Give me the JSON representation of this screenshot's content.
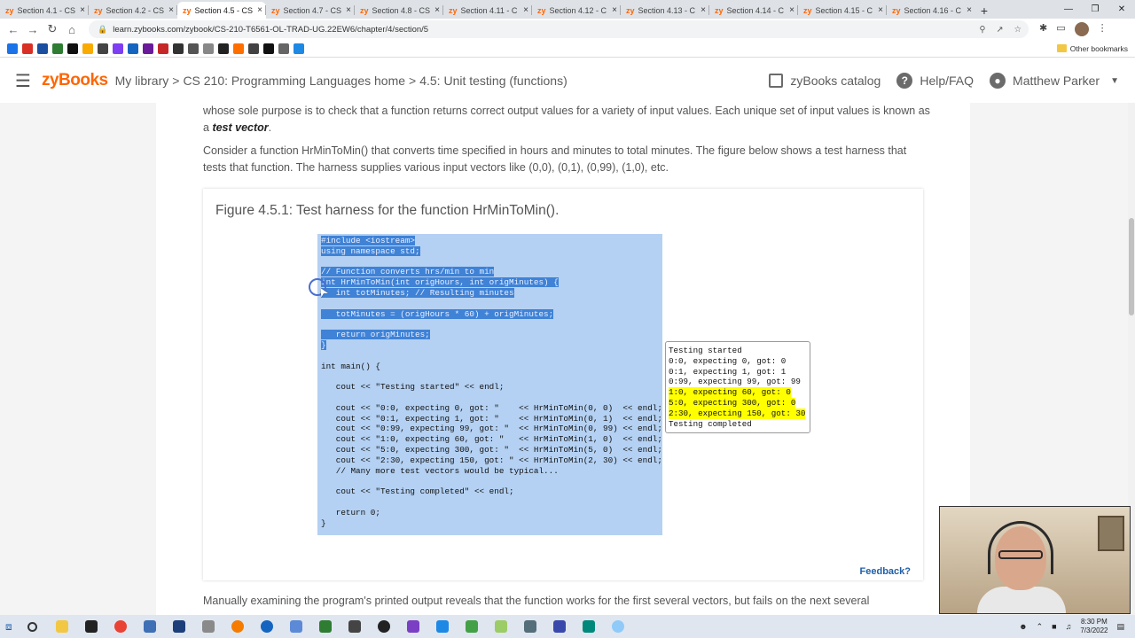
{
  "browser": {
    "tabs": [
      {
        "label": "Section 4.1 - CS",
        "active": false
      },
      {
        "label": "Section 4.2 - CS",
        "active": false
      },
      {
        "label": "Section 4.5 - CS",
        "active": true
      },
      {
        "label": "Section 4.7 - CS",
        "active": false
      },
      {
        "label": "Section 4.8 - CS",
        "active": false
      },
      {
        "label": "Section 4.11 - C",
        "active": false
      },
      {
        "label": "Section 4.12 - C",
        "active": false
      },
      {
        "label": "Section 4.13 - C",
        "active": false
      },
      {
        "label": "Section 4.14 - C",
        "active": false
      },
      {
        "label": "Section 4.15 - C",
        "active": false
      },
      {
        "label": "Section 4.16 - C",
        "active": false
      }
    ],
    "tab_favicon": "zy",
    "url": "learn.zybooks.com/zybook/CS-210-T6561-OL-TRAD-UG.22EW6/chapter/4/section/5",
    "other_bookmarks": "Other bookmarks"
  },
  "header": {
    "logo": "zyBooks",
    "breadcrumb": [
      "My library",
      "CS 210: Programming Languages home",
      "4.5: Unit testing (functions)"
    ],
    "breadcrumb_sep": ">",
    "catalog": "zyBooks catalog",
    "help": "Help/FAQ",
    "user": "Matthew Parker"
  },
  "content": {
    "para1_text": "whose sole purpose is to check that a function returns correct output values for a variety of input values. Each unique set of input values is known as a ",
    "para1_term": "test vector",
    "para1_end": ".",
    "para2": "Consider a function HrMinToMin() that converts time specified in hours and minutes to total minutes. The figure below shows a test harness that tests that function. The harness supplies various input vectors like (0,0), (0,1), (0,99), (1,0), etc.",
    "figure_title": "Figure 4.5.1: Test harness for the function HrMinToMin().",
    "code_lines": [
      "#include <iostream>",
      "using namespace std;",
      "",
      "// Function converts hrs/min to min",
      "int HrMinToMin(int origHours, int origMinutes) {",
      "   int totMinutes; // Resulting minutes",
      "",
      "   totMinutes = (origHours * 60) + origMinutes;",
      "",
      "   return origMinutes;",
      "}",
      "",
      "int main() {",
      "",
      "   cout << \"Testing started\" << endl;",
      "",
      "   cout << \"0:0, expecting 0, got: \"    << HrMinToMin(0, 0)  << endl;",
      "   cout << \"0:1, expecting 1, got: \"    << HrMinToMin(0, 1)  << endl;",
      "   cout << \"0:99, expecting 99, got: \"  << HrMinToMin(0, 99) << endl;",
      "   cout << \"1:0, expecting 60, got: \"   << HrMinToMin(1, 0)  << endl;",
      "   cout << \"5:0, expecting 300, got: \"  << HrMinToMin(5, 0)  << endl;",
      "   cout << \"2:30, expecting 150, got: \" << HrMinToMin(2, 30) << endl;",
      "   // Many more test vectors would be typical...",
      "",
      "   cout << \"Testing completed\" << endl;",
      "",
      "   return 0;",
      "}"
    ],
    "output_lines": [
      {
        "text": "Testing started",
        "highlight": false
      },
      {
        "text": "0:0, expecting 0, got: 0",
        "highlight": false
      },
      {
        "text": "0:1, expecting 1, got: 1",
        "highlight": false
      },
      {
        "text": "0:99, expecting 99, got: 99",
        "highlight": false
      },
      {
        "text": "1:0, expecting 60, got: 0",
        "highlight": true
      },
      {
        "text": "5:0, expecting 300, got: 0",
        "highlight": true
      },
      {
        "text": "2:30, expecting 150, got: 30",
        "highlight": true
      },
      {
        "text": "Testing completed",
        "highlight": false
      }
    ],
    "feedback": "Feedback?",
    "para3": "Manually examining the program's printed output reveals that the function works for the first several vectors, but fails on the next several"
  },
  "taskbar": {
    "time": "8:30 PM",
    "date": "7/3/2022"
  },
  "colors": {
    "brand": "#ff6600",
    "code_bg": "#b4d1f3",
    "selection": "#3f82d6",
    "output_highlight": "#ffff00",
    "link": "#1f5fa8"
  }
}
